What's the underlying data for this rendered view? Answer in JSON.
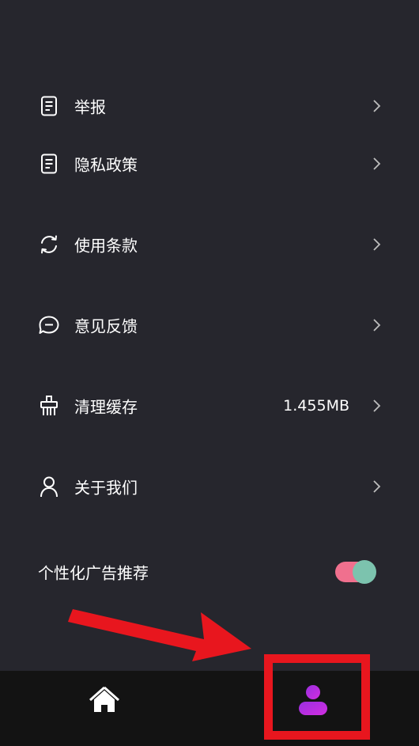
{
  "menu": {
    "items": [
      {
        "label": "举报",
        "icon": "document-icon"
      },
      {
        "label": "隐私政策",
        "icon": "document-icon"
      },
      {
        "label": "使用条款",
        "icon": "refresh-icon"
      },
      {
        "label": "意见反馈",
        "icon": "chat-bubble-icon"
      },
      {
        "label": "清理缓存",
        "icon": "broom-icon",
        "value": "1.455MB"
      },
      {
        "label": "关于我们",
        "icon": "person-icon"
      }
    ]
  },
  "ad_setting": {
    "label": "个性化广告推荐",
    "enabled": true
  },
  "bottom_nav": {
    "items": [
      {
        "icon": "home-icon",
        "active": false
      },
      {
        "icon": "profile-icon",
        "active": true
      }
    ]
  },
  "colors": {
    "background": "#26262d",
    "nav_background": "#131313",
    "toggle_track": "#f0708e",
    "toggle_knob": "#7cc3ae",
    "annotation_red": "#e8161e",
    "profile_gradient_start": "#9b2fe0",
    "profile_gradient_end": "#d12ee0"
  }
}
